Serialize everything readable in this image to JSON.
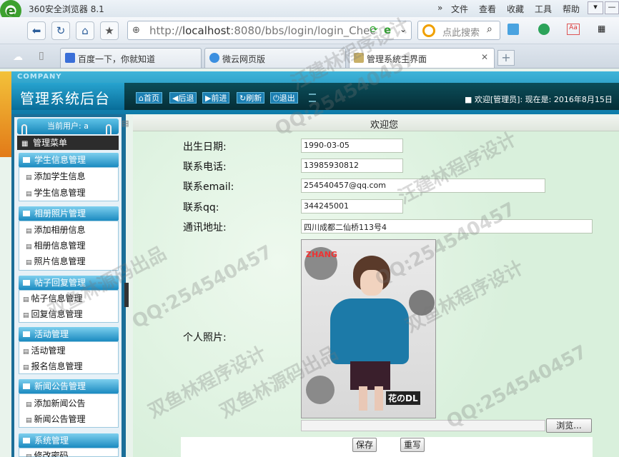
{
  "window": {
    "app_logo": "e",
    "title": "360安全浏览器 8.1",
    "menu": [
      "文件",
      "查看",
      "收藏",
      "工具",
      "帮助"
    ]
  },
  "navbar": {
    "url_prefix": "http://",
    "url_host": "localhost",
    "url_rest": ":8080/bbs/login/login_Chec",
    "search_placeholder": "点此搜索"
  },
  "tabs": [
    {
      "label": "百度一下，你就知道",
      "active": false
    },
    {
      "label": "微云网页版",
      "active": false
    },
    {
      "label": "管理系统主界面",
      "active": true
    }
  ],
  "header": {
    "company": "COMPANY",
    "system_title": "管理系统后台",
    "toolbar": [
      "首页",
      "后退",
      "前进",
      "刷新",
      "退出"
    ],
    "welcome": "■ 欢迎[管理员]:   现在是: 2016年8月15日"
  },
  "sidebar": {
    "current_user": "当前用户: a",
    "menu_header": "管理菜单",
    "groups": [
      {
        "title": "学生信息管理",
        "items": [
          "添加学生信息",
          "学生信息管理"
        ]
      },
      {
        "title": "相册照片管理",
        "items": [
          "添加相册信息",
          "相册信息管理",
          "照片信息管理"
        ]
      },
      {
        "title": "帖子回复管理",
        "items": [
          "帖子信息管理",
          "回复信息管理"
        ]
      },
      {
        "title": "活动管理",
        "items": [
          "活动管理",
          "报名信息管理"
        ]
      },
      {
        "title": "新闻公告管理",
        "items": [
          "添加新闻公告",
          "新闻公告管理"
        ]
      },
      {
        "title": "系统管理",
        "items": [
          "修改密码"
        ]
      }
    ]
  },
  "content": {
    "title": "欢迎您",
    "fields": {
      "birth_label": "出生日期:",
      "birth_value": "1990-03-05",
      "phone_label": "联系电话:",
      "phone_value": "13985930812",
      "email_label": "联系email:",
      "email_value": "254540457@qq.com",
      "qq_label": "联系qq:",
      "qq_value": "344245001",
      "address_label": "通讯地址:",
      "address_value": "四川成都二仙桥113号4",
      "photo_label": "个人照片:"
    },
    "photo_text": {
      "top": "ZHANG",
      "bottom": "花のDL"
    },
    "browse_button": "浏览...",
    "save_button": "保存",
    "reset_button": "重写"
  },
  "watermarks": [
    "QQ:254540457",
    "双鱼林源码出品",
    "汪建林程序设计",
    "双鱼林程序设计",
    "QQ:254540457",
    "双鱼林源码出品",
    "汪建林程序设计",
    "QQ:254540457",
    "双鱼林程序设计",
    "QQ:254540457"
  ]
}
